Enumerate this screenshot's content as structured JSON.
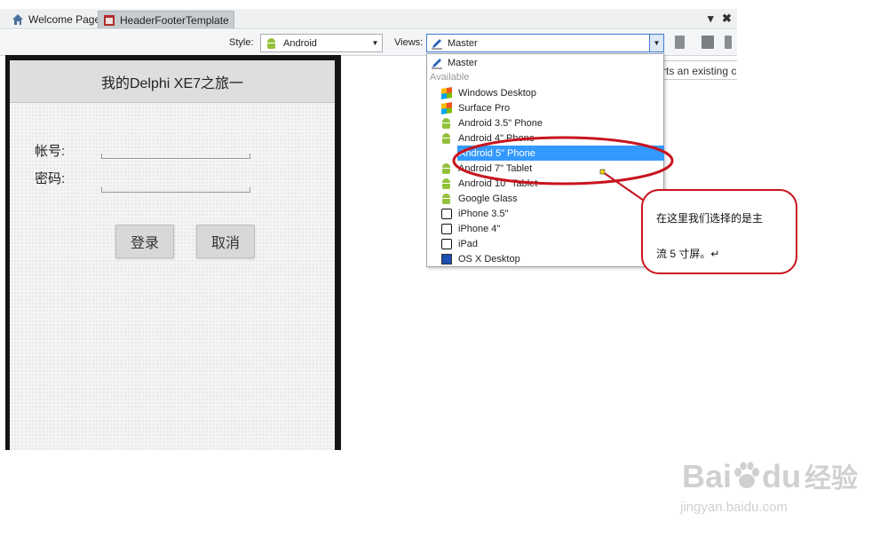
{
  "tabs": {
    "items": [
      {
        "label": "Welcome Page"
      },
      {
        "label": "HeaderFooterTemplate"
      }
    ],
    "controls": {
      "dropdown": "▾",
      "close": "✖"
    }
  },
  "toolbar": {
    "style_label": "Style:",
    "style_value": "Android",
    "views_label": "Views:",
    "views_value": "Master"
  },
  "background_snippet": "rts an existing c",
  "form": {
    "header_title": "我的Delphi XE7之旅一",
    "account_label": "帐号:",
    "password_label": "密码:",
    "login_button": "登录",
    "cancel_button": "取消"
  },
  "views_dropdown": {
    "master": "Master",
    "available_label": "Available",
    "items": [
      {
        "label": "Windows Desktop",
        "icon": "windows-icon"
      },
      {
        "label": "Surface Pro",
        "icon": "windows-icon"
      },
      {
        "label": "Android 3.5\" Phone",
        "icon": "android-icon"
      },
      {
        "label": "Android 4\" Phone",
        "icon": "android-icon"
      },
      {
        "label": "Android 5\" Phone",
        "icon": "android-icon",
        "selected": true
      },
      {
        "label": "Android 7\" Tablet",
        "icon": "android-icon"
      },
      {
        "label": "Android 10\" Tablet",
        "icon": "android-icon"
      },
      {
        "label": "Google Glass",
        "icon": "android-icon"
      },
      {
        "label": "iPhone 3.5\"",
        "icon": "phone-icon"
      },
      {
        "label": "iPhone 4\"",
        "icon": "phone-icon"
      },
      {
        "label": "iPad",
        "icon": "phone-icon"
      },
      {
        "label": "OS X Desktop",
        "icon": "mac-icon"
      }
    ]
  },
  "annotation": {
    "line1": "在这里我们选择的是主",
    "line2": "流 5 寸屏。↵",
    "color": "#c8141e"
  },
  "watermark": {
    "brand": "Bai",
    "brand2": "du",
    "suffix": "经验",
    "url": "jingyan.baidu.com"
  },
  "colors": {
    "selection": "#3399ff",
    "android_green": "#94c13c"
  }
}
